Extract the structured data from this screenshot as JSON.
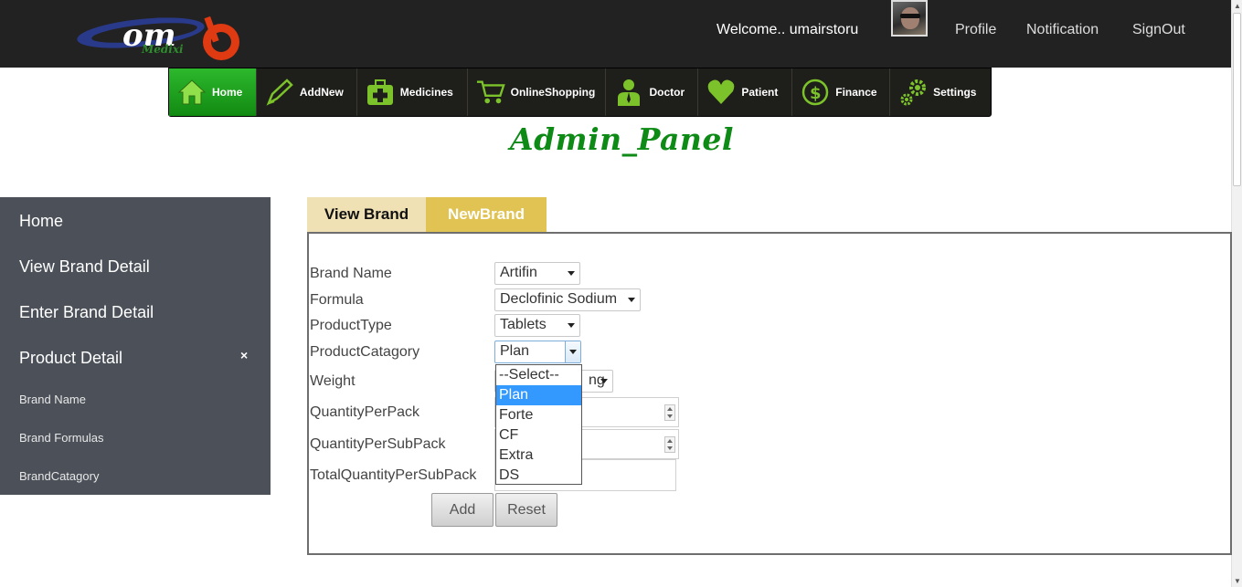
{
  "header": {
    "logo_alt": "Medixi",
    "welcome": "Welcome.. umairstoru",
    "links": {
      "profile": "Profile",
      "notification": "Notification",
      "signout": "SignOut"
    }
  },
  "nav": {
    "items": [
      {
        "label": "Home",
        "icon": "home-icon",
        "active": true
      },
      {
        "label": "AddNew",
        "icon": "pencil-icon"
      },
      {
        "label": "Medicines",
        "icon": "medkit-icon"
      },
      {
        "label": "OnlineShopping",
        "icon": "cart-icon"
      },
      {
        "label": "Doctor",
        "icon": "doctor-icon"
      },
      {
        "label": "Patient",
        "icon": "heart-icon"
      },
      {
        "label": "Finance",
        "icon": "dollar-icon"
      },
      {
        "label": "Settings",
        "icon": "gears-icon"
      }
    ]
  },
  "title": "Admin_Panel",
  "sidebar": {
    "items": [
      "Home",
      "View Brand Detail",
      "Enter Brand Detail",
      "Product Detail"
    ],
    "close": "×",
    "sub_items": [
      "Brand Name",
      "Brand Formulas",
      "BrandCatagory"
    ]
  },
  "tabs": {
    "view": "View Brand",
    "new": "NewBrand"
  },
  "form": {
    "labels": {
      "brand_name": "Brand Name",
      "formula": "Formula",
      "product_type": "ProductType",
      "product_category": "ProductCatagory",
      "weight": "Weight",
      "qty_per_pack": "QuantityPerPack",
      "qty_per_subpack": "QuantityPerSubPack",
      "total_qty_per_subpack": "TotalQuantityPerSubPack"
    },
    "values": {
      "brand_name": "Artifin",
      "formula": "Declofinic Sodium",
      "product_type": "Tablets",
      "product_category": "Plan",
      "weight_visible": "ng"
    },
    "category_options": [
      "--Select--",
      "Plan",
      "Forte",
      "CF",
      "Extra",
      "DS"
    ],
    "category_selected_index": 1,
    "buttons": {
      "add": "Add",
      "reset": "Reset"
    }
  },
  "colors": {
    "nav_active": "#1ea31e",
    "title": "#0e8a16",
    "sidebar": "#4b5059",
    "tab_new": "#e0c353",
    "tab_view": "#efe1b4"
  }
}
